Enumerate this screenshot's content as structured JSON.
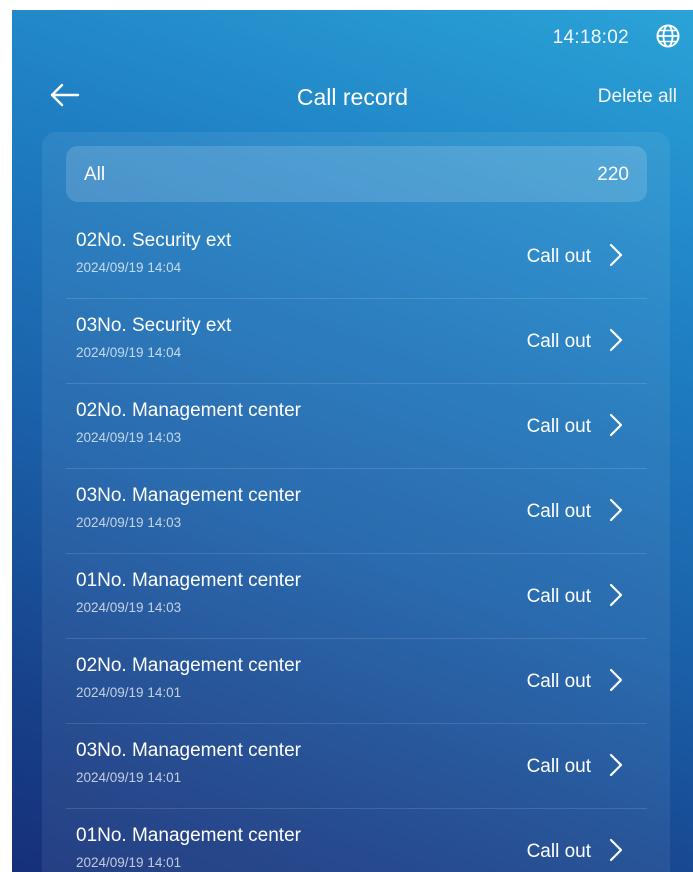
{
  "status": {
    "time": "14:18:02",
    "globe_icon": "globe-icon"
  },
  "header": {
    "back_icon": "arrow-left-icon",
    "title": "Call record",
    "delete_all": "Delete all"
  },
  "filter": {
    "label": "All",
    "count": "220"
  },
  "records": [
    {
      "name": "02No. Security ext",
      "time": "2024/09/19 14:04",
      "action": "Call out"
    },
    {
      "name": "03No. Security ext",
      "time": "2024/09/19 14:04",
      "action": "Call out"
    },
    {
      "name": "02No. Management center",
      "time": "2024/09/19 14:03",
      "action": "Call out"
    },
    {
      "name": "03No. Management center",
      "time": "2024/09/19 14:03",
      "action": "Call out"
    },
    {
      "name": "01No. Management center",
      "time": "2024/09/19 14:03",
      "action": "Call out"
    },
    {
      "name": "02No. Management center",
      "time": "2024/09/19 14:01",
      "action": "Call out"
    },
    {
      "name": "03No. Management center",
      "time": "2024/09/19 14:01",
      "action": "Call out"
    },
    {
      "name": "01No. Management center",
      "time": "2024/09/19 14:01",
      "action": "Call out"
    }
  ]
}
